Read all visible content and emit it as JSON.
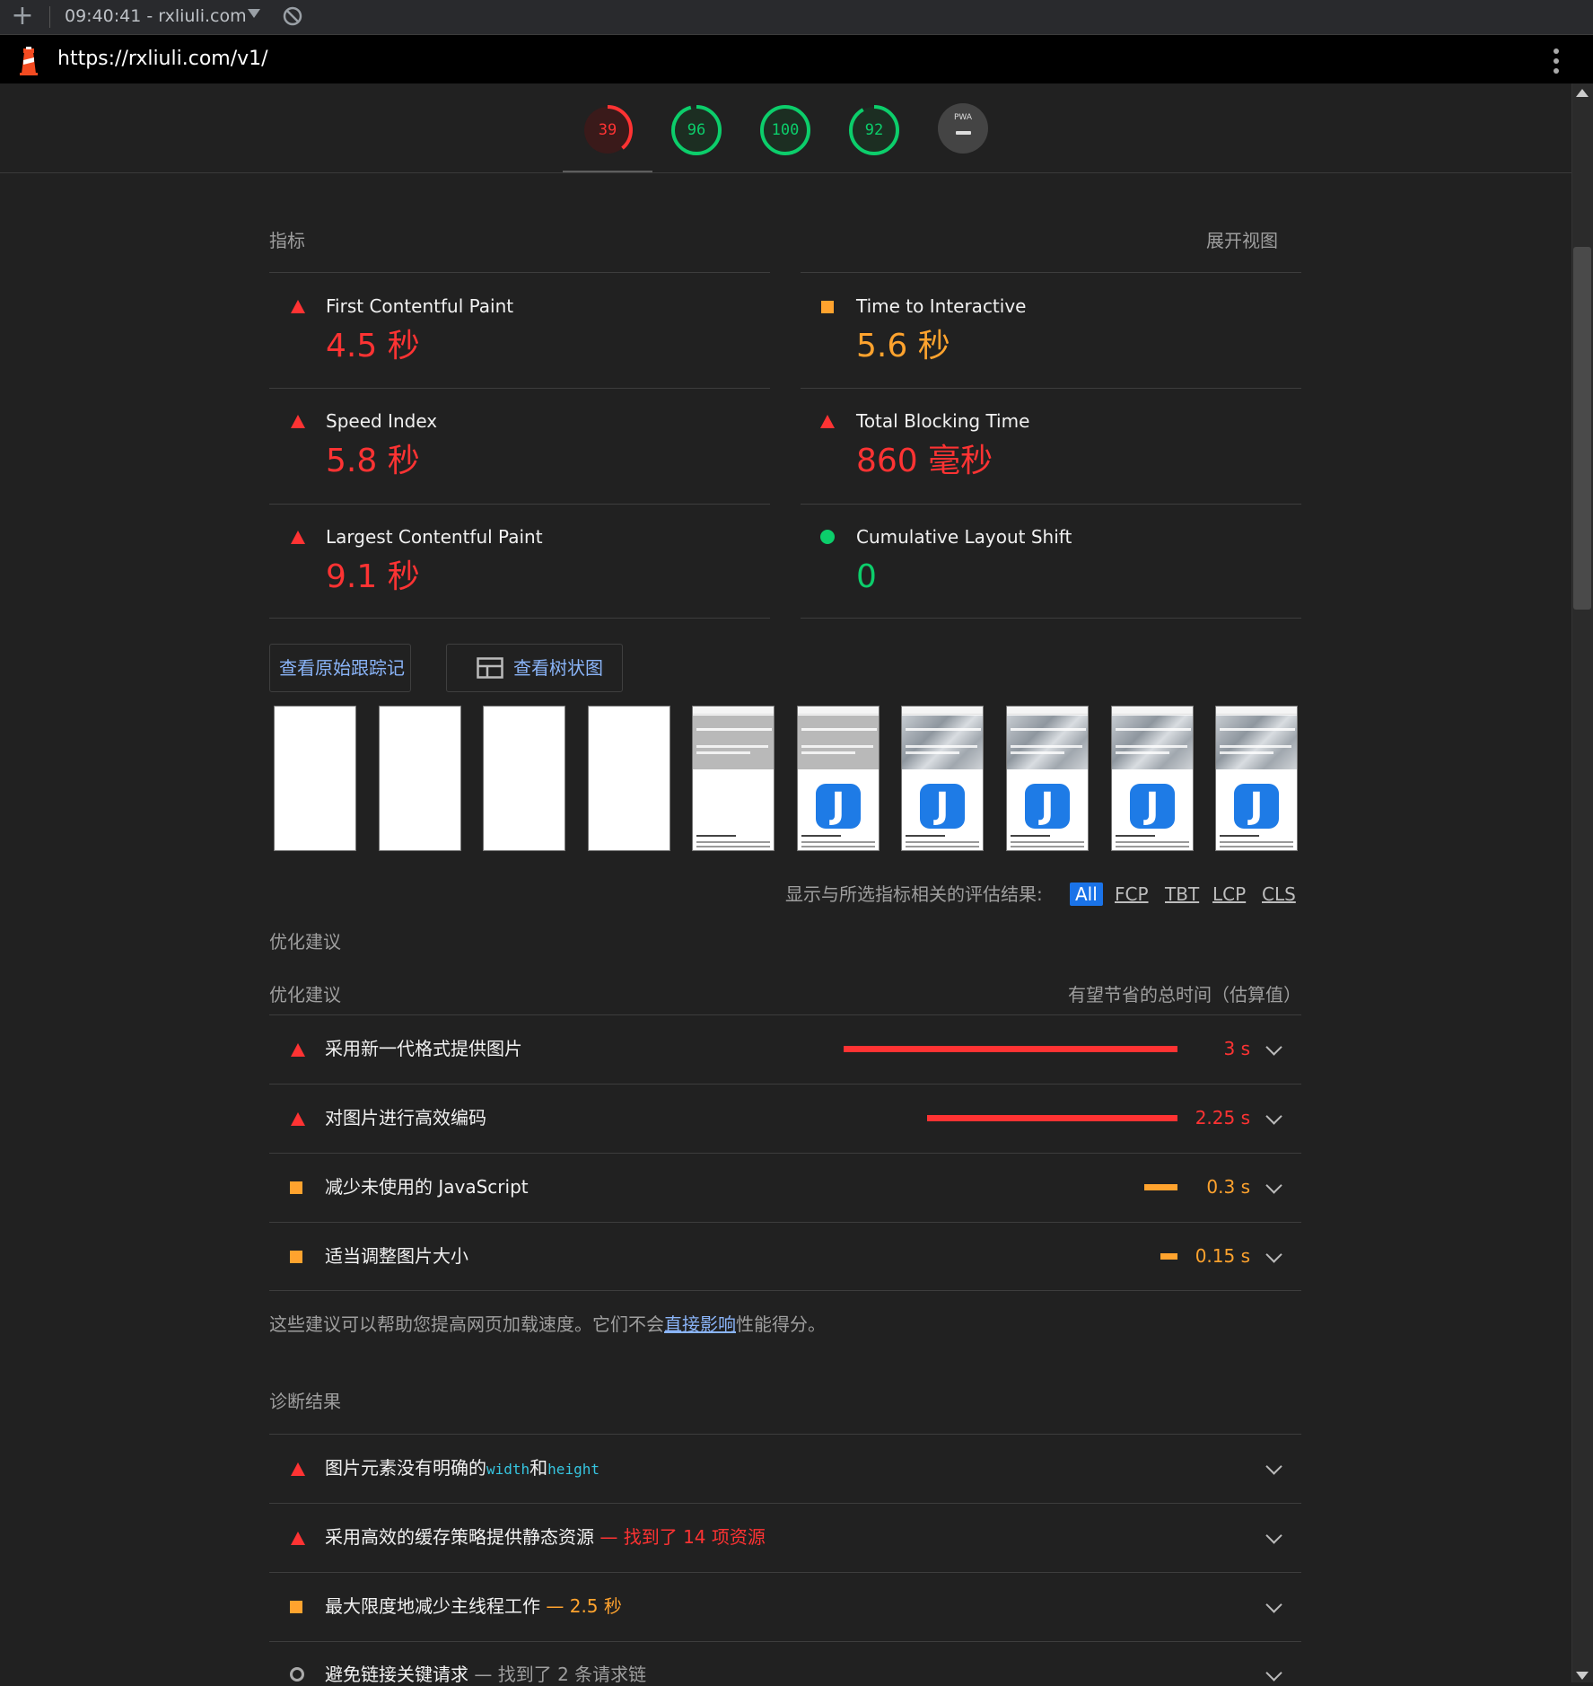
{
  "toolbar": {
    "session_label": "09:40:41 - rxliuli.com",
    "plus_icon": "+"
  },
  "urlbar": {
    "url": "https://rxliuli.com/v1/"
  },
  "gauges": [
    {
      "label": "39",
      "score": 39,
      "color": "#f33"
    },
    {
      "label": "96",
      "score": 96,
      "color": "#0cce6b"
    },
    {
      "label": "100",
      "score": 100,
      "color": "#0cce6b"
    },
    {
      "label": "92",
      "score": 92,
      "color": "#0cce6b"
    }
  ],
  "pwa": {
    "label": "PWA"
  },
  "metrics": {
    "section_title": "指标",
    "toggle_label": "展开视图",
    "items": [
      {
        "name": "First Contentful Paint",
        "value": "4.5 秒",
        "status": "fail",
        "color": "#f33"
      },
      {
        "name": "Time to Interactive",
        "value": "5.6 秒",
        "status": "average",
        "color": "#ffa32e"
      },
      {
        "name": "Speed Index",
        "value": "5.8 秒",
        "status": "fail",
        "color": "#f33"
      },
      {
        "name": "Total Blocking Time",
        "value": "860 毫秒",
        "status": "fail",
        "color": "#f33"
      },
      {
        "name": "Largest Contentful Paint",
        "value": "9.1 秒",
        "status": "fail",
        "color": "#f33"
      },
      {
        "name": "Cumulative Layout Shift",
        "value": "0",
        "status": "pass",
        "color": "#0cce6b"
      }
    ]
  },
  "buttons": {
    "view_trace": "查看原始跟踪记录",
    "view_treemap": "查看树状图"
  },
  "filmstrip": {
    "frame_icon_letter": "J",
    "frames": [
      "blank",
      "blank",
      "blank",
      "blank",
      "banner",
      "banner-icon",
      "image-icon",
      "image-icon",
      "image-icon",
      "image-icon"
    ]
  },
  "filters": {
    "label": "显示与所选指标相关的评估结果:",
    "options": [
      "All",
      "FCP",
      "TBT",
      "LCP",
      "CLS"
    ]
  },
  "opportunities": {
    "section_title": "优化建议",
    "column_left": "优化建议",
    "column_right": "有望节省的总时间（估算值）",
    "items": [
      {
        "title": "采用新一代格式提供图片",
        "saving": "3 s",
        "saving_fraction": 1.0,
        "status": "fail",
        "color": "#f33"
      },
      {
        "title": "对图片进行高效编码",
        "saving": "2.25 s",
        "saving_fraction": 0.75,
        "status": "fail",
        "color": "#f33"
      },
      {
        "title": "减少未使用的 JavaScript",
        "saving": "0.3 s",
        "saving_fraction": 0.1,
        "status": "average",
        "color": "#ffa32e"
      },
      {
        "title": "适当调整图片大小",
        "saving": "0.15 s",
        "saving_fraction": 0.05,
        "status": "average",
        "color": "#ffa32e"
      }
    ],
    "footer_prefix": "这些建议可以帮助您提高网页加载速度。它们不会",
    "footer_link": "直接影响",
    "footer_suffix": "性能得分。"
  },
  "diagnostics": {
    "section_title": "诊断结果",
    "item1": {
      "prefix": "图片元素没有明确的",
      "code1": "width",
      "mid": "和",
      "code2": "height"
    },
    "item2": {
      "title": "采用高效的缓存策略提供静态资源",
      "detail": "— 找到了 14 项资源"
    },
    "item3": {
      "title": "最大限度地减少主线程工作",
      "detail": "— 2.5 秒"
    },
    "item4": {
      "title": "避免链接关键请求",
      "detail": "— 找到了 2 条请求链"
    }
  },
  "colors": {
    "fail": "#f33",
    "average": "#ffa32e",
    "pass": "#0cce6b",
    "link": "#8ab4f8",
    "background": "#212121"
  }
}
